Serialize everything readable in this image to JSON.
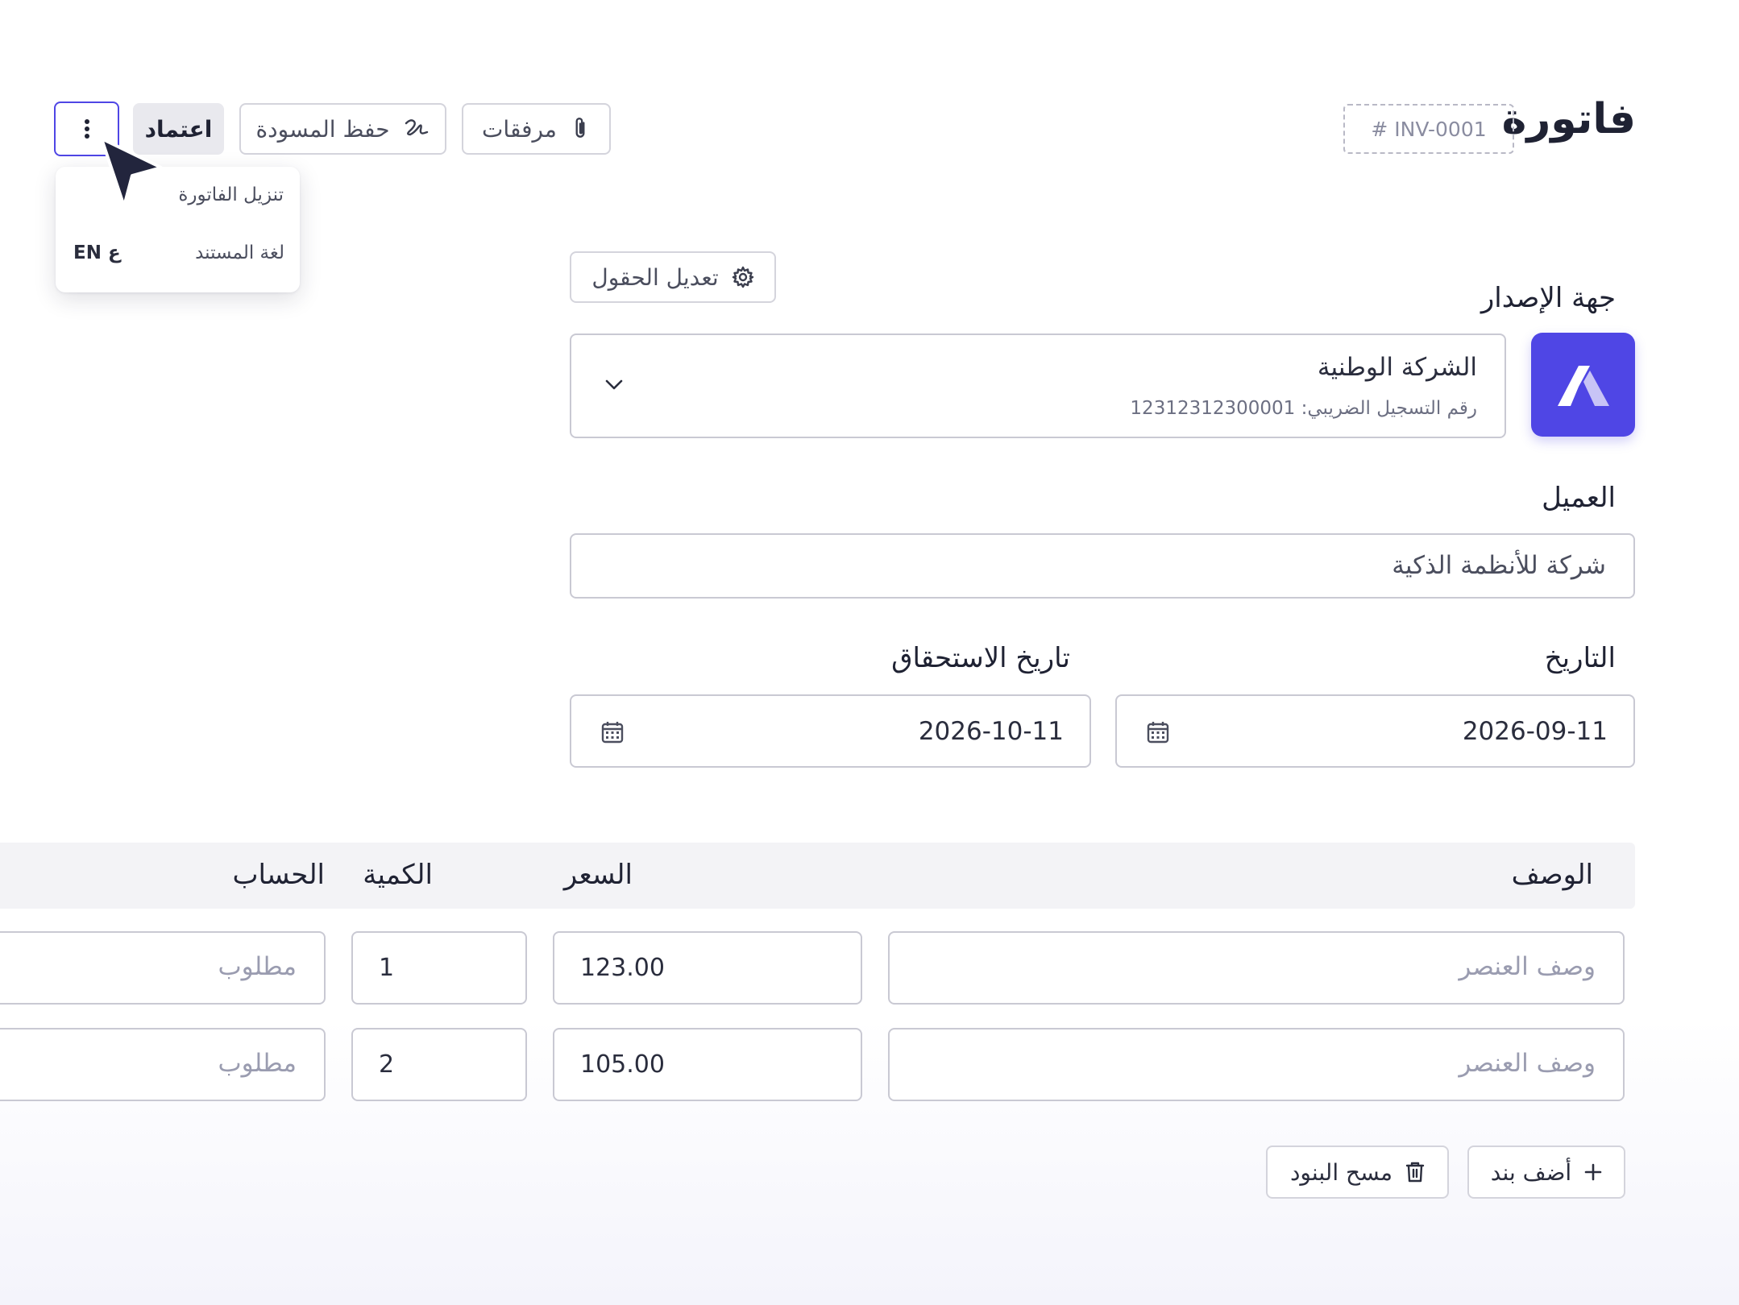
{
  "header": {
    "title": "فاتورة",
    "invoice_number": "# INV-0001"
  },
  "toolbar": {
    "attachments_label": "مرفقات",
    "save_draft_label": "حفظ المسودة",
    "approve_label": "اعتماد"
  },
  "more_menu": {
    "download_label": "تنزيل الفاتورة",
    "document_language_label": "لغة المستند",
    "language_toggle": "ع EN"
  },
  "issuer": {
    "label": "جهة الإصدار",
    "edit_fields_label": "تعديل الحقول",
    "company_name": "الشركة الوطنية",
    "tax_registration": "رقم التسجيل الضريبي: 12312312300001"
  },
  "customer": {
    "label": "العميل",
    "value": "شركة للأنظمة الذكية"
  },
  "dates": {
    "date_label": "التاريخ",
    "date_value": "2026-09-11",
    "due_label": "تاريخ الاستحقاق",
    "due_value": "2026-10-11"
  },
  "items_table": {
    "headers": {
      "description": "الوصف",
      "price": "السعر",
      "quantity": "الكمية",
      "account": "الحساب"
    },
    "rows": [
      {
        "description_placeholder": "وصف العنصر",
        "price": "123.00",
        "quantity": "1",
        "account_placeholder": "مطلوب"
      },
      {
        "description_placeholder": "وصف العنصر",
        "price": "105.00",
        "quantity": "2",
        "account_placeholder": "مطلوب"
      }
    ]
  },
  "item_actions": {
    "add_item_label": "أضف بند",
    "clear_items_label": "مسح البنود"
  },
  "colors": {
    "accent": "#4f46e5",
    "text_dark": "#1f2233",
    "border": "#c9c9d3",
    "table_header_bg": "#f3f3f6"
  }
}
